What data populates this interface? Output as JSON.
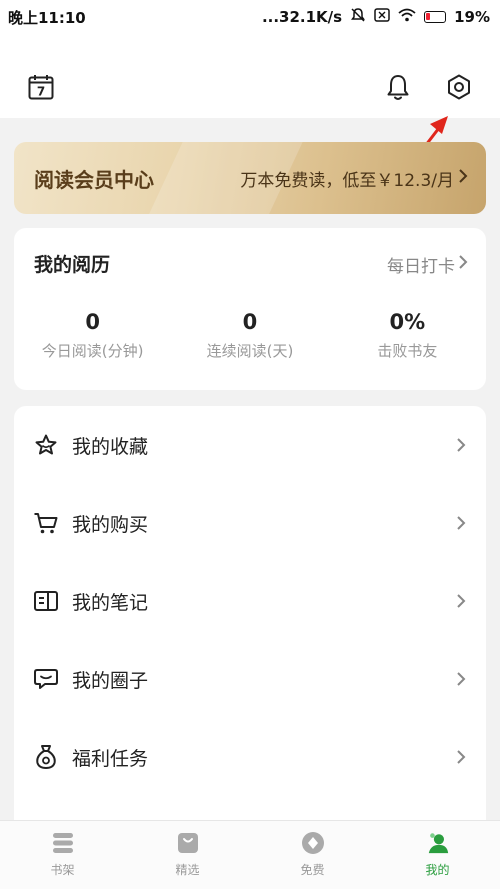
{
  "status_bar": {
    "time": "晚上11:10",
    "network_speed": "...32.1K/s",
    "battery": "19%",
    "icons": [
      "mute-icon",
      "sim-icon",
      "wifi-icon",
      "battery-icon"
    ]
  },
  "header": {
    "icons": [
      "calendar-icon",
      "bell-icon",
      "settings-icon"
    ],
    "calendar_day": "7"
  },
  "vip_banner": {
    "title": "阅读会员中心",
    "promo": "万本免费读，低至￥12.3/月"
  },
  "reading_record": {
    "title": "我的阅历",
    "checkin": "每日打卡",
    "stats": [
      {
        "value": "0",
        "label": "今日阅读(分钟)"
      },
      {
        "value": "0",
        "label": "连续阅读(天)"
      },
      {
        "value": "0%",
        "label": "击败书友"
      }
    ]
  },
  "menu": [
    {
      "label": "我的收藏",
      "icon": "star-icon"
    },
    {
      "label": "我的购买",
      "icon": "cart-icon"
    },
    {
      "label": "我的笔记",
      "icon": "notebook-icon"
    },
    {
      "label": "我的圈子",
      "icon": "chat-bubble-icon"
    },
    {
      "label": "福利任务",
      "icon": "money-bag-icon"
    }
  ],
  "tab_bar": {
    "tabs": [
      {
        "label": "书架",
        "icon": "bookshelf-icon",
        "active": false
      },
      {
        "label": "精选",
        "icon": "shopping-bag-icon",
        "active": false
      },
      {
        "label": "免费",
        "icon": "diamond-icon",
        "active": false
      },
      {
        "label": "我的",
        "icon": "profile-icon",
        "active": true
      }
    ]
  },
  "colors": {
    "accent_green": "#2a9d3e",
    "vip_gold": "#dcc08e",
    "annotation_red": "#e0261c"
  }
}
